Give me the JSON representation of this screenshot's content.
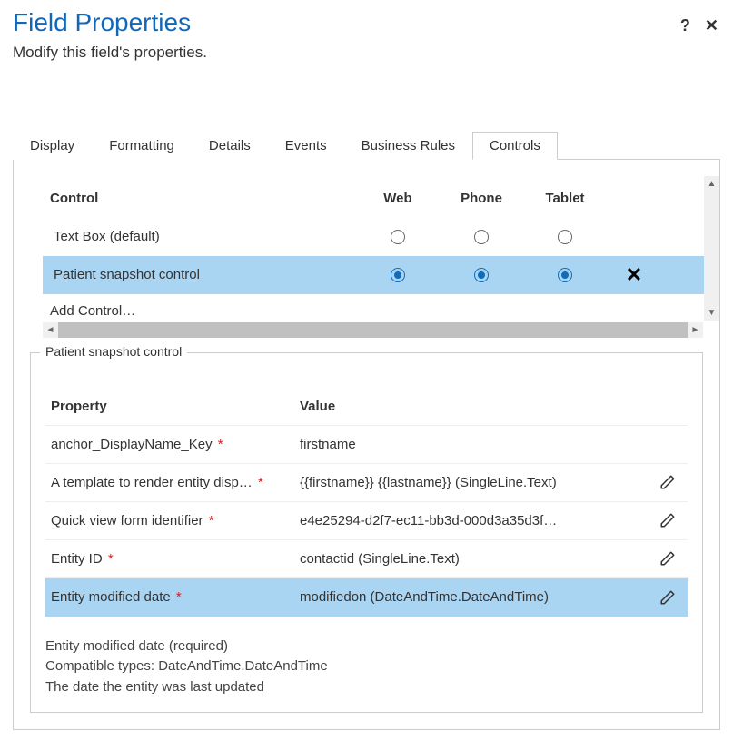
{
  "header": {
    "title": "Field Properties",
    "subtitle": "Modify this field's properties.",
    "help": "?",
    "close": "✕"
  },
  "tabs": [
    {
      "label": "Display",
      "active": false
    },
    {
      "label": "Formatting",
      "active": false
    },
    {
      "label": "Details",
      "active": false
    },
    {
      "label": "Events",
      "active": false
    },
    {
      "label": "Business Rules",
      "active": false
    },
    {
      "label": "Controls",
      "active": true
    }
  ],
  "controls_table": {
    "headers": {
      "control": "Control",
      "web": "Web",
      "phone": "Phone",
      "tablet": "Tablet"
    },
    "rows": [
      {
        "name": "Text Box (default)",
        "web": false,
        "phone": false,
        "tablet": false,
        "selected": false,
        "deletable": false
      },
      {
        "name": "Patient snapshot control",
        "web": true,
        "phone": true,
        "tablet": true,
        "selected": true,
        "deletable": true
      }
    ],
    "add_control": "Add Control…"
  },
  "fieldset": {
    "legend": "Patient snapshot control",
    "headers": {
      "property": "Property",
      "value": "Value"
    },
    "rows": [
      {
        "prop": "anchor_DisplayName_Key",
        "required": true,
        "val": "firstname",
        "editable": false,
        "selected": false
      },
      {
        "prop": "A template to render entity disp…",
        "required": true,
        "val": "{{firstname}} {{lastname}} (SingleLine.Text)",
        "editable": true,
        "selected": false
      },
      {
        "prop": "Quick view form identifier",
        "required": true,
        "val": "e4e25294-d2f7-ec11-bb3d-000d3a35d3f…",
        "editable": true,
        "selected": false
      },
      {
        "prop": "Entity ID",
        "required": true,
        "val": "contactid (SingleLine.Text)",
        "editable": true,
        "selected": false
      },
      {
        "prop": "Entity modified date",
        "required": true,
        "val": "modifiedon (DateAndTime.DateAndTime)",
        "editable": true,
        "selected": true
      }
    ],
    "help": {
      "line1": "Entity modified date (required)",
      "line2": "Compatible types: DateAndTime.DateAndTime",
      "line3": "The date the entity was last updated"
    }
  }
}
